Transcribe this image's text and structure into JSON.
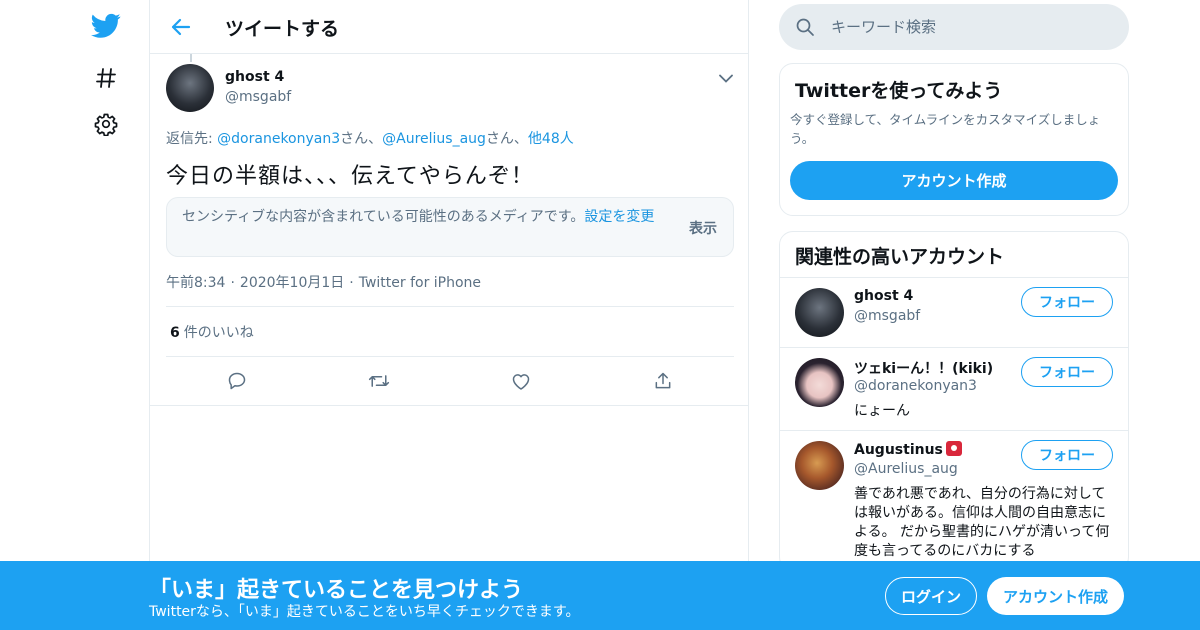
{
  "colors": {
    "brand": "#1da1f2",
    "link": "#1b95e0",
    "muted": "#5b7083",
    "border": "#e6ecf0"
  },
  "nav": {
    "items": [
      {
        "icon": "twitter-logo-icon"
      },
      {
        "icon": "hashtag-icon"
      },
      {
        "icon": "gear-icon"
      }
    ]
  },
  "header": {
    "title": "ツイートする"
  },
  "tweet": {
    "name": "ghost 4",
    "handle": "@msgabf",
    "reply_prefix": "返信先: ",
    "reply_user1": "@doranekonyan3",
    "reply_san1": "さん、",
    "reply_user2": "@Aurelius_aug",
    "reply_san2": "さん、",
    "reply_others": "他48人",
    "text": "今日の半額は、、、伝えてやらんぞ！",
    "sensitive_msg": "センシティブな内容が含まれている可能性のあるメディアです。",
    "sensitive_link": "設定を変更",
    "sensitive_show": "表示",
    "time": "午前8:34",
    "date": "2020年10月1日",
    "client": "Twitter for iPhone",
    "likes_count": "6",
    "likes_label": "件のいいね"
  },
  "search": {
    "placeholder": "キーワード検索"
  },
  "signup_card": {
    "title": "Twitterを使ってみよう",
    "desc": "今すぐ登録して、タイムラインをカスタマイズしましょう。",
    "button": "アカウント作成"
  },
  "related": {
    "title": "関連性の高いアカウント",
    "follow_label": "フォロー",
    "accounts": [
      {
        "name": "ghost 4",
        "handle": "@msgabf",
        "bio": ""
      },
      {
        "name": "ツェkiーん！！(kiki)",
        "handle": "@doranekonyan3",
        "bio": "にょーん"
      },
      {
        "name": "Augustinus",
        "handle": "@Aurelius_aug",
        "bio": "善であれ悪であれ、自分の行為に対しては報いがある。信仰は人間の自由意志による。 だから聖書的にハゲが清いって何度も言ってるのにバカにする"
      }
    ]
  },
  "banner": {
    "title": "「いま」起きていることを見つけよう",
    "subtitle": "Twitterなら、「いま」起きていることをいち早くチェックできます。",
    "login": "ログイン",
    "signup": "アカウント作成"
  }
}
